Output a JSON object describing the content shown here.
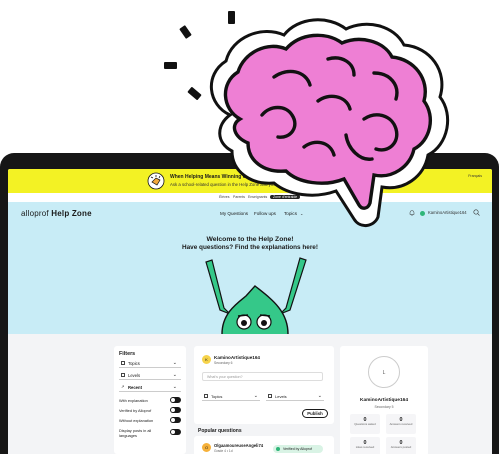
{
  "banner": {
    "title": "When Helping Means Winning contest",
    "text": "Ask a school-related question in the Help Zone and you could win a p",
    "lang": "Français"
  },
  "subnav": {
    "items": [
      "Élèves",
      "Parents",
      "Enseignants",
      "Zone d'entraide"
    ],
    "active_index": 3
  },
  "header": {
    "logo_light": "alloprof",
    "logo_bold": "Help Zone",
    "nav": [
      "My Questions",
      "Follow ups",
      "Topics"
    ],
    "username": "KaminoArtistique164"
  },
  "hero": {
    "line1": "Welcome to the Help Zone!",
    "line2": "Have questions? Find the explanations here!"
  },
  "filters": {
    "title": "Filters",
    "topics": "Topics",
    "levels": "Levels",
    "sort": "Recent",
    "toggles": [
      "With explanation",
      "Verified by Alloprof",
      "Without explanation",
      "Display posts in all languages"
    ]
  },
  "ask": {
    "username": "KaminoArtistique164",
    "sub": "Secondary 6",
    "placeholder": "What's your question?",
    "topics": "Topics",
    "levels": "Levels",
    "publish": "Publish"
  },
  "popular": {
    "title": "Popular questions",
    "item_user": "OlgaamoureuseAngeli74",
    "item_sub": "Grade 4 • 1d",
    "verified": "Verified by Alloprof"
  },
  "profile": {
    "avatar_letter": "L",
    "username": "KaminoArtistique164",
    "sub": "Secondary 5",
    "stats": [
      {
        "value": "0",
        "label": "Questions asked"
      },
      {
        "value": "0",
        "label": "Answers received"
      },
      {
        "value": "0",
        "label": "Likes received"
      },
      {
        "value": "0",
        "label": "Answers posted"
      }
    ]
  },
  "colors": {
    "banner": "#f3f224",
    "hero": "#c8ecf6",
    "brain": "#ee7fd4",
    "mascot": "#35c889"
  },
  "icons": [
    "hand-megaphone-icon",
    "bell-icon",
    "search-icon",
    "chevron-down-icon",
    "brain-icon"
  ]
}
